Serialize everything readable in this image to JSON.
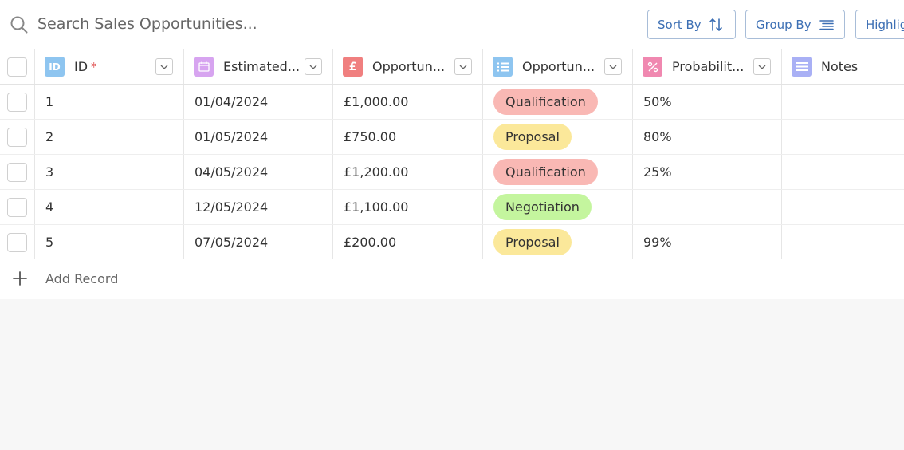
{
  "search": {
    "placeholder": "Search Sales Opportunities..."
  },
  "toolbar": {
    "sort_label": "Sort By",
    "group_label": "Group By",
    "highlight_label": "Highlight"
  },
  "columns": [
    {
      "label": "ID",
      "required_mark": "*",
      "icon": "id-icon",
      "color": "#8ec5f0",
      "glyph": "ID"
    },
    {
      "label": "Estimated...",
      "icon": "calendar-icon",
      "color": "#d7a4f0"
    },
    {
      "label": "Opportun...",
      "icon": "pound-icon",
      "color": "#f07f7f",
      "glyph": "£"
    },
    {
      "label": "Opportun...",
      "icon": "list-icon",
      "color": "#8ec5f0"
    },
    {
      "label": "Probabilit...",
      "icon": "percent-icon",
      "color": "#f088b0"
    },
    {
      "label": "Notes",
      "icon": "notes-icon",
      "color": "#a9b0f5"
    }
  ],
  "stage_colors": {
    "Qualification": "#f9b8b4",
    "Proposal": "#fbe89a",
    "Negotiation": "#c4f59e"
  },
  "rows": [
    {
      "id": "1",
      "date": "01/04/2024",
      "value": "£1,000.00",
      "stage": "Qualification",
      "probability": "50%",
      "notes": ""
    },
    {
      "id": "2",
      "date": "01/05/2024",
      "value": "£750.00",
      "stage": "Proposal",
      "probability": "80%",
      "notes": ""
    },
    {
      "id": "3",
      "date": "04/05/2024",
      "value": "£1,200.00",
      "stage": "Qualification",
      "probability": "25%",
      "notes": ""
    },
    {
      "id": "4",
      "date": "12/05/2024",
      "value": "£1,100.00",
      "stage": "Negotiation",
      "probability": "",
      "notes": ""
    },
    {
      "id": "5",
      "date": "07/05/2024",
      "value": "£200.00",
      "stage": "Proposal",
      "probability": "99%",
      "notes": ""
    }
  ],
  "add_record_label": "Add Record"
}
